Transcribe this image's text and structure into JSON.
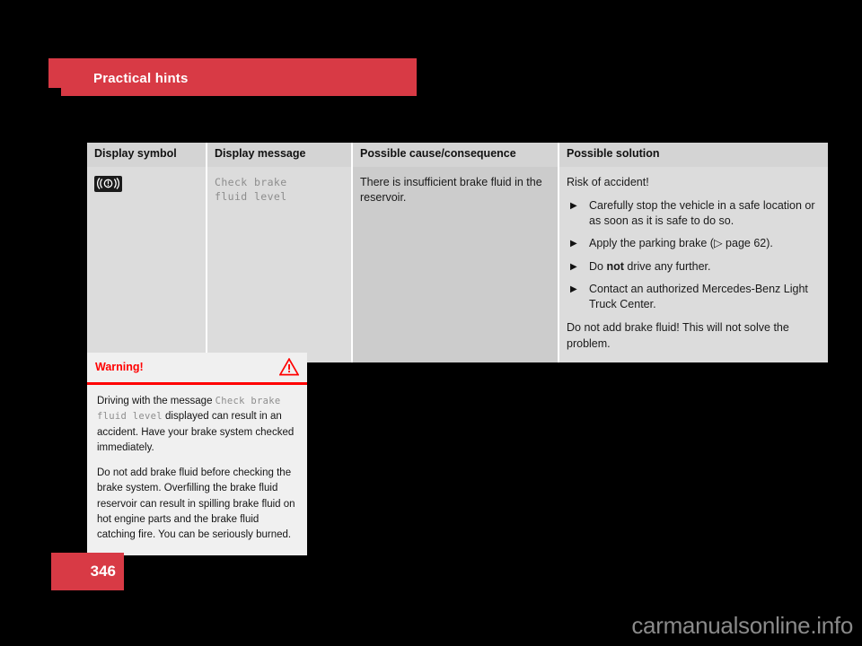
{
  "chapter": {
    "title": "Practical hints"
  },
  "table": {
    "headers": [
      "Display symbol",
      "Display message",
      "Possible cause/consequence",
      "Possible solution"
    ],
    "row": {
      "symbol_icon": "brake-warning-lamp-icon",
      "display_message": "Check brake\nfluid level",
      "display_message_line1": "Check brake",
      "display_message_line2": "fluid level",
      "cause": "There is insufficient brake fluid in the reservoir.",
      "solution": {
        "lead": "Risk of accident!",
        "bullets": [
          "Carefully stop the vehicle in a safe location or as soon as it is safe to do so.",
          "Apply the parking brake (▷ page 62).",
          "Do not drive any further.",
          "Contact an authorized Mercedes-Benz Light Truck Center."
        ],
        "bullet_glyph": "▶",
        "tail": "Do not add brake fluid! This will not solve the problem."
      }
    }
  },
  "warning": {
    "title": "Warning!",
    "icon": "warning-triangle-icon",
    "paragraph_1_prefix": "Driving with the message ",
    "paragraph_1_mono": "Check brake fluid level",
    "paragraph_1_suffix": " displayed can result in an accident. Have your brake system checked immediately.",
    "paragraph_2": "Do not add brake fluid before checking the brake system. Overfilling the brake fluid reservoir can result in spilling brake fluid on hot engine parts and the brake fluid catching fire. You can be seriously burned."
  },
  "footer": {
    "page_number": "346",
    "watermark": "carmanualsonline.info"
  },
  "colors": {
    "brand_red": "#d83a45",
    "warning_red": "#ff0000",
    "table_header_gray": "#d4d4d4",
    "cell_gray_light": "#dcdcdc",
    "cell_gray_dark": "#cccccc",
    "page_background": "#000000"
  }
}
